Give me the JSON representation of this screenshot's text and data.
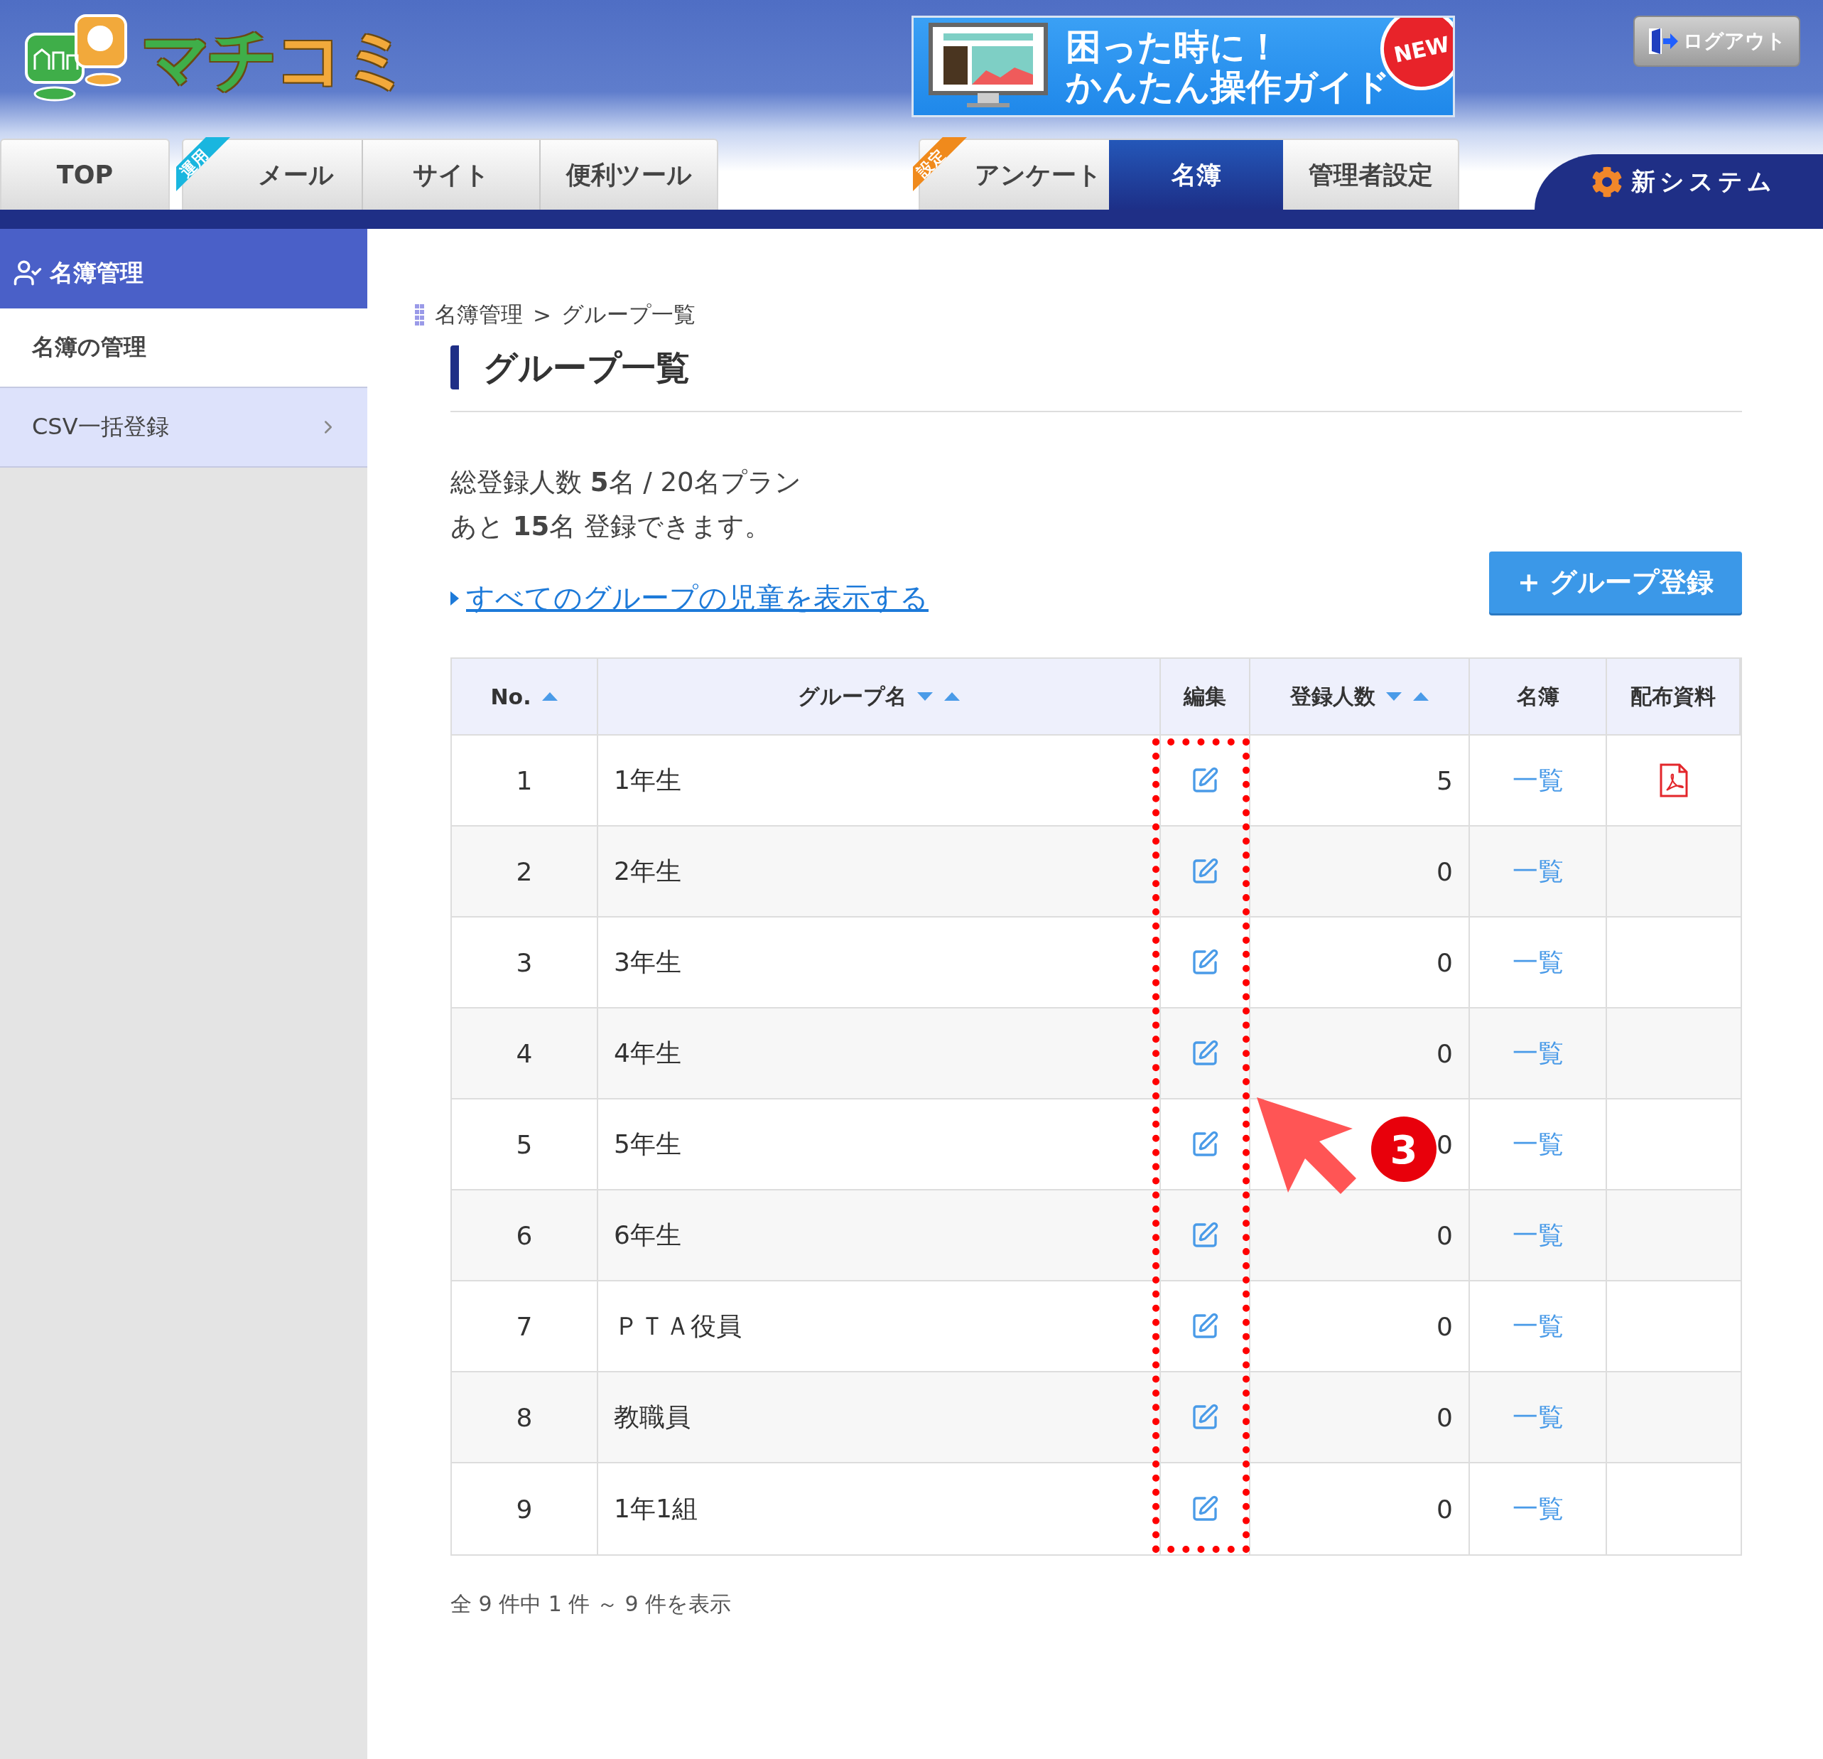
{
  "logo": {
    "parts": [
      {
        "text": "マチ",
        "color": "#3fae49"
      },
      {
        "text": "コミ",
        "color": "#f2a93b"
      }
    ]
  },
  "banner": {
    "lines": [
      "困った時に！",
      "かんたん操作ガイド"
    ],
    "badge": "NEW"
  },
  "logout": {
    "label": "ログアウト"
  },
  "tab_groups": [
    {
      "tabs": [
        {
          "label": "TOP",
          "selected": false
        }
      ]
    },
    {
      "badge": {
        "label": "運用",
        "color": "#19b6df"
      },
      "tabs": [
        {
          "label": "メール",
          "selected": false
        },
        {
          "label": "サイト",
          "selected": false
        },
        {
          "label": "便利ツール",
          "selected": false
        }
      ]
    },
    {
      "badge": {
        "label": "設定",
        "color": "#f08a1c"
      },
      "tabs": [
        {
          "label": "アンケート",
          "selected": false
        },
        {
          "label": "名簿",
          "selected": true
        },
        {
          "label": "管理者設定",
          "selected": false
        }
      ]
    }
  ],
  "new_system": {
    "label": "新システム"
  },
  "sidebar": {
    "title": "名簿管理",
    "items": [
      {
        "label": "名簿の管理",
        "selected": true
      },
      {
        "label": "CSV一括登録",
        "selected": false
      }
    ]
  },
  "breadcrumb": [
    "名簿管理",
    "グループ一覧"
  ],
  "breadcrumb_separator": ">",
  "page_title": "グループ一覧",
  "summary": [
    "総登録人数 **5**名 / 20名プラン",
    "あと **15**名 登録できます。"
  ],
  "show_all_link": "すべてのグループの児童を表示する",
  "add_button": "+ グループ登録",
  "table": {
    "columns": [
      {
        "label": "No.",
        "sort_down": false,
        "sort_up": true
      },
      {
        "label": "グループ名",
        "sort_down": true,
        "sort_up": true
      },
      {
        "label": "編集",
        "sort_down": false,
        "sort_up": false
      },
      {
        "label": "登録人数",
        "sort_down": true,
        "sort_up": true
      },
      {
        "label": "名簿",
        "sort_down": false,
        "sort_up": false
      },
      {
        "label": "配布資料",
        "sort_down": false,
        "sort_up": false
      }
    ],
    "rows": [
      {
        "no": "1",
        "name": "1年生",
        "count": "5",
        "list": "一覧",
        "handout": true
      },
      {
        "no": "2",
        "name": "2年生",
        "count": "0",
        "list": "一覧",
        "handout": false
      },
      {
        "no": "3",
        "name": "3年生",
        "count": "0",
        "list": "一覧",
        "handout": false
      },
      {
        "no": "4",
        "name": "4年生",
        "count": "0",
        "list": "一覧",
        "handout": false
      },
      {
        "no": "5",
        "name": "5年生",
        "count": "0",
        "list": "一覧",
        "handout": false
      },
      {
        "no": "6",
        "name": "6年生",
        "count": "0",
        "list": "一覧",
        "handout": false
      },
      {
        "no": "7",
        "name": "ＰＴＡ役員",
        "count": "0",
        "list": "一覧",
        "handout": false
      },
      {
        "no": "8",
        "name": "教職員",
        "count": "0",
        "list": "一覧",
        "handout": false
      },
      {
        "no": "9",
        "name": "1年1組",
        "count": "0",
        "list": "一覧",
        "handout": false
      }
    ]
  },
  "pagination": "全 9 件中 1 件 ～ 9 件を表示",
  "annotation": {
    "step": "3"
  }
}
